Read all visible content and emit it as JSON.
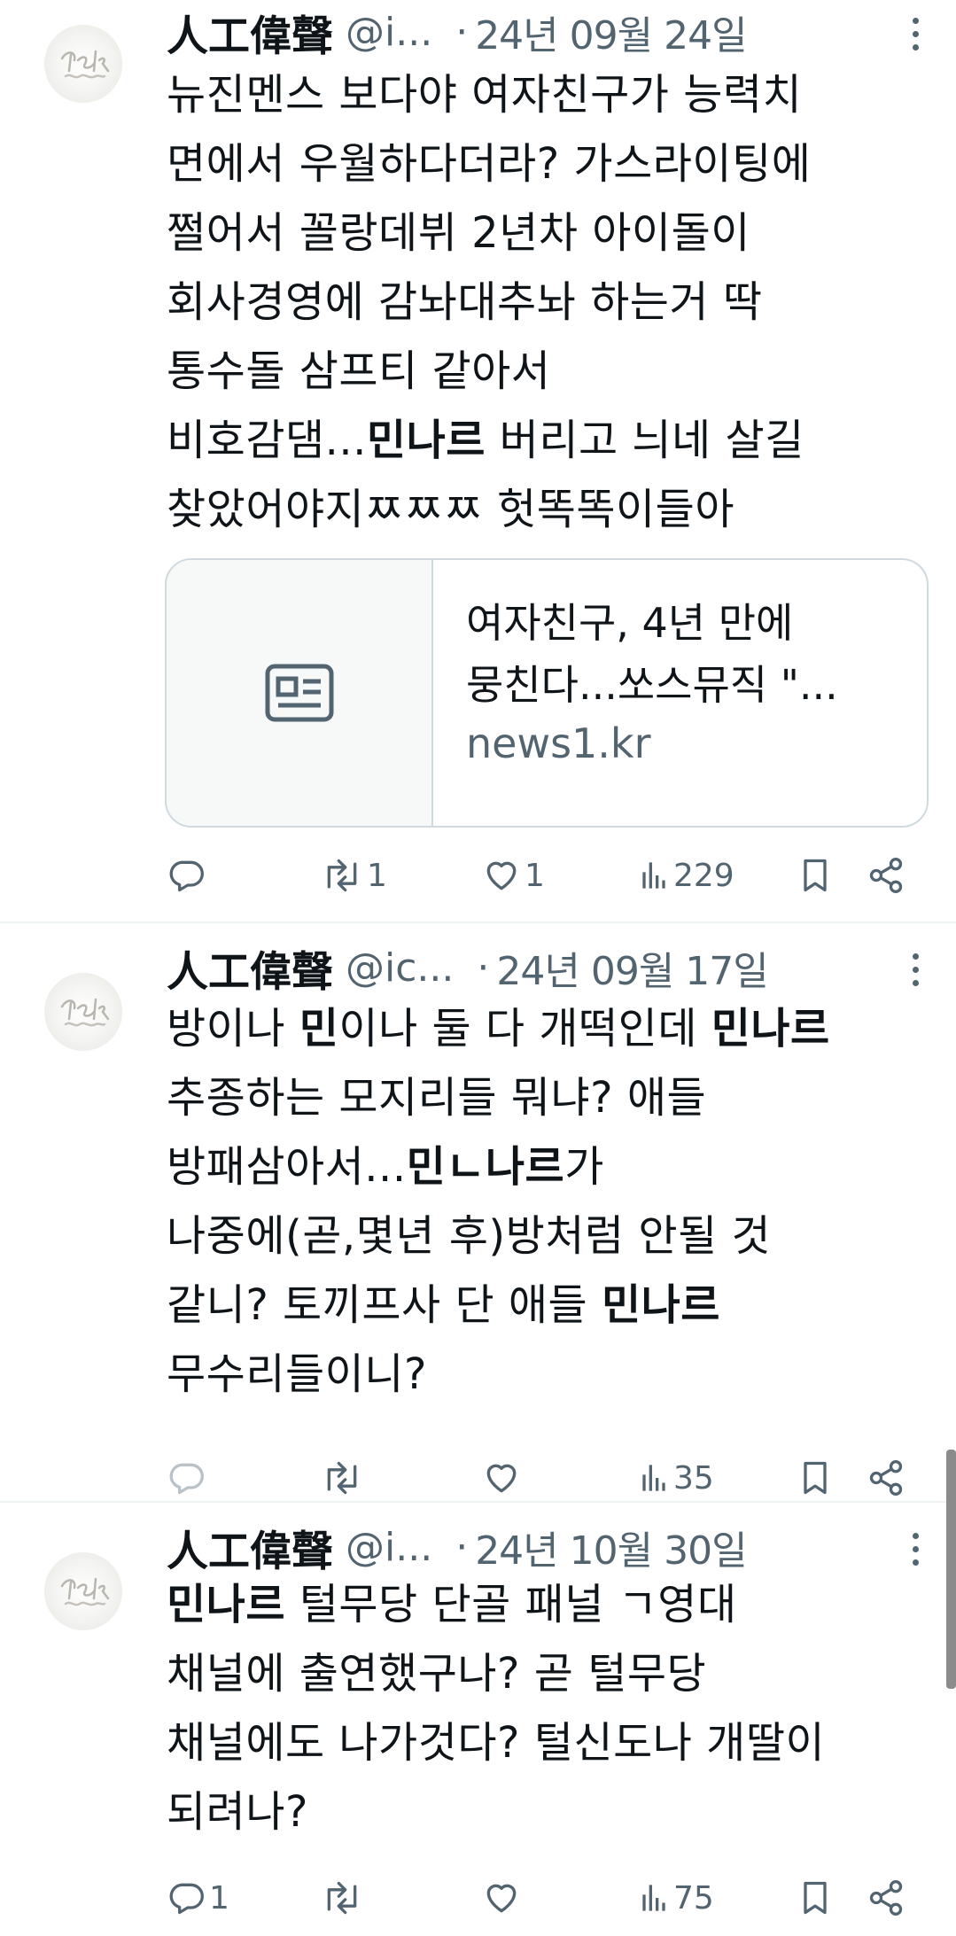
{
  "tweets": [
    {
      "name": "人工偉聲",
      "handle": "@i...",
      "date": "24년 09월 24일",
      "text_parts": [
        {
          "t": "뉴진멘스 보다야 여자친구가 능력치\n면에서 우월하다더라? 가스라이팅에\n쩔어서 꼴랑데뷔 2년차 아이돌이\n회사경영에 감놔대추놔 하는거 딱\n통수돌 삼프티 같아서\n비호감댐...",
          "b": false
        },
        {
          "t": "민나르",
          "b": true
        },
        {
          "t": " 버리고 늬네 살길\n찾았어야지ㅉㅉㅉ 헛똑똑이들아",
          "b": false
        }
      ],
      "card": {
        "title": "여자친구, 4년 만에\n뭉친다...쏘스뮤직 \"...",
        "domain": "news1.kr"
      },
      "actions": {
        "replies": "",
        "reposts": "1",
        "likes": "1",
        "views": "229"
      }
    },
    {
      "name": "人工偉聲",
      "handle": "@ic...",
      "date": "24년 09월 17일",
      "text_parts": [
        {
          "t": "방이나 ",
          "b": false
        },
        {
          "t": "민",
          "b": true
        },
        {
          "t": "이나 둘 다 개떡인데 ",
          "b": false
        },
        {
          "t": "민나르",
          "b": true
        },
        {
          "t": "\n추종하는 모지리들 뭐냐? 애들\n방패삼아서...",
          "b": false
        },
        {
          "t": "민ㄴ나르",
          "b": true
        },
        {
          "t": "가\n나중에(곧,몇년 후)방처럼 안될 것\n같니? 토끼프사 단 애들 ",
          "b": false
        },
        {
          "t": "민나르",
          "b": true
        },
        {
          "t": "\n무수리들이니?",
          "b": false
        }
      ],
      "actions": {
        "replies": "",
        "reposts": "",
        "likes": "",
        "views": "35"
      }
    },
    {
      "name": "人工偉聲",
      "handle": "@i...",
      "date": "24년 10월 30일",
      "text_parts": [
        {
          "t": "민나르",
          "b": true
        },
        {
          "t": " 털무당 단골 패널 ㄱ영대\n채널에 출연했구나? 곧 털무당\n채널에도 나가것다? 털신도나 개딸이\n되려나?",
          "b": false
        }
      ],
      "actions": {
        "replies": "1",
        "reposts": "",
        "likes": "",
        "views": "75"
      }
    }
  ],
  "icons": {
    "reply": "reply-icon",
    "repost": "repost-icon",
    "like": "heart-icon",
    "views": "views-chart-icon",
    "bookmark": "bookmark-icon",
    "share": "share-icon",
    "more": "more-vertical-icon",
    "card_thumb": "article-icon"
  },
  "colors": {
    "text": "#0f1419",
    "muted": "#536471",
    "border": "#cfd9de"
  }
}
